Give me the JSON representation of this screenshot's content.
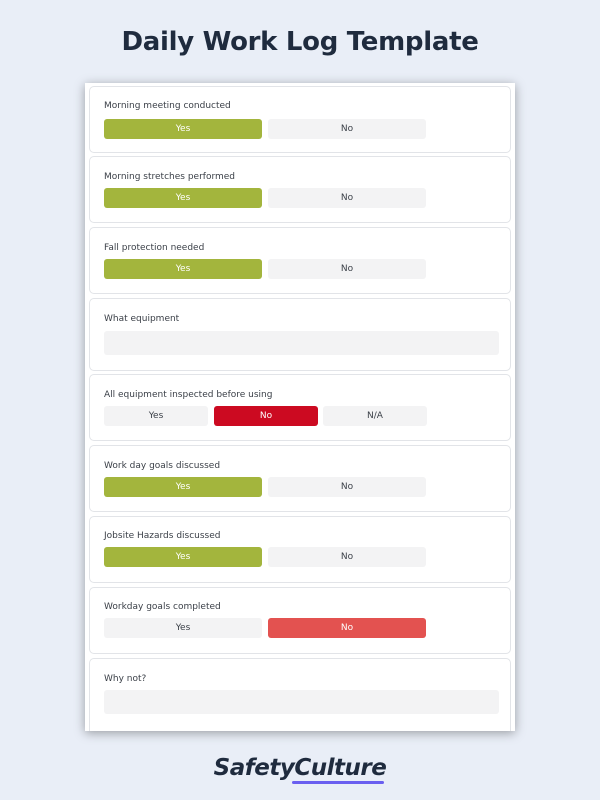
{
  "page": {
    "title": "Daily Work Log Template",
    "brand": "SafetyCulture"
  },
  "colors": {
    "background": "#e9eef7",
    "yes_selected": "#a3b53d",
    "no_selected_red": "#cc0a21",
    "no_selected_salmon": "#e35250",
    "option_default": "#f3f3f4"
  },
  "questions": [
    {
      "label": "Morning meeting conducted",
      "options": [
        "Yes",
        "No"
      ],
      "selected": "Yes"
    },
    {
      "label": "Morning stretches performed",
      "options": [
        "Yes",
        "No"
      ],
      "selected": "Yes"
    },
    {
      "label": "Fall protection needed",
      "options": [
        "Yes",
        "No"
      ],
      "selected": "Yes"
    },
    {
      "label": "What equipment",
      "type": "text",
      "value": ""
    },
    {
      "label": "All equipment inspected before using",
      "options": [
        "Yes",
        "No",
        "N/A"
      ],
      "selected": "No"
    },
    {
      "label": "Work day goals discussed",
      "options": [
        "Yes",
        "No"
      ],
      "selected": "Yes"
    },
    {
      "label": "Jobsite Hazards discussed",
      "options": [
        "Yes",
        "No"
      ],
      "selected": "Yes"
    },
    {
      "label": "Workday goals completed",
      "options": [
        "Yes",
        "No"
      ],
      "selected": "No"
    },
    {
      "label": "Why not?",
      "type": "text",
      "value": ""
    }
  ]
}
